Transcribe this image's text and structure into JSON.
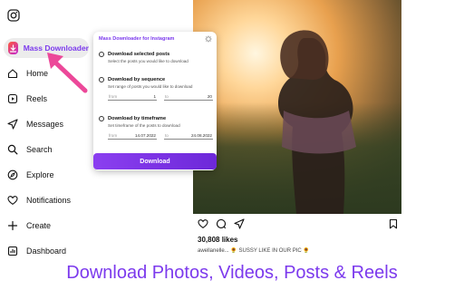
{
  "extension_pill": {
    "label": "Mass Downloader"
  },
  "nav": [
    {
      "label": "Home",
      "icon": "home-icon"
    },
    {
      "label": "Reels",
      "icon": "reels-icon"
    },
    {
      "label": "Messages",
      "icon": "messages-icon"
    },
    {
      "label": "Search",
      "icon": "search-icon"
    },
    {
      "label": "Explore",
      "icon": "explore-icon"
    },
    {
      "label": "Notifications",
      "icon": "heart-icon"
    },
    {
      "label": "Create",
      "icon": "plus-icon"
    },
    {
      "label": "Dashboard",
      "icon": "dashboard-icon"
    }
  ],
  "panel": {
    "title": "Mass Downloader for Instagram",
    "options": [
      {
        "title": "Download selected posts",
        "desc": "Select the posts you would like to download"
      },
      {
        "title": "Download by sequence",
        "desc": "Set range of posts you would like to download",
        "from_placeholder": "from",
        "from_value": "1",
        "to_placeholder": "to",
        "to_value": "20"
      },
      {
        "title": "Download by timeframe",
        "desc": "Set timeframe of the posts to download",
        "from_placeholder": "from",
        "from_value": "14.07.2022",
        "to_placeholder": "to",
        "to_value": "24.08.2022"
      }
    ],
    "download_label": "Download"
  },
  "post": {
    "likes": "30,808 likes",
    "caption": "awellanelle... 🌻 SUSSY LIKE IN OUR PIC 🌻"
  },
  "banner": {
    "text": "Download Photos, Videos, Posts & Reels"
  },
  "colors": {
    "accent": "#7c3aed",
    "button": "#6d28d9",
    "arrow": "#ec4899"
  }
}
